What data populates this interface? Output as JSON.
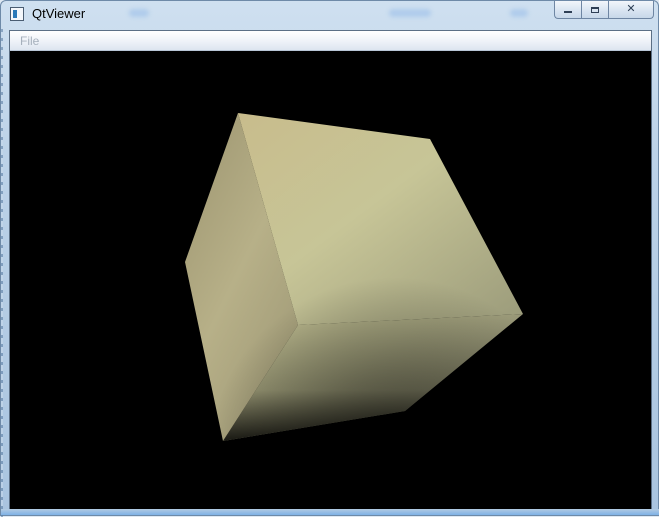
{
  "window": {
    "title": "QtViewer",
    "app_icon": "qt-app-icon"
  },
  "caption_buttons": {
    "minimize": {
      "icon": "minimize-icon",
      "glyph": ""
    },
    "maximize": {
      "icon": "maximize-icon",
      "glyph": ""
    },
    "close": {
      "icon": "close-icon",
      "glyph": "✕"
    }
  },
  "menubar": {
    "items": [
      {
        "label": "File",
        "state": "disabled"
      }
    ]
  },
  "viewport": {
    "background_color": "#000000",
    "content": "shaded-3d-cube",
    "cube_colors": {
      "top_face": "#c9c394",
      "front_face": "#a7a67c",
      "left_face": "#9d9673",
      "shadow": "#1b1b14"
    }
  }
}
